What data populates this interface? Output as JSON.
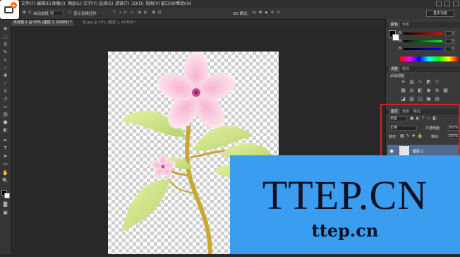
{
  "menu": [
    {
      "label": "文件(F)"
    },
    {
      "label": "编辑(E)"
    },
    {
      "label": "图像(I)"
    },
    {
      "label": "图层(L)"
    },
    {
      "label": "文字(Y)"
    },
    {
      "label": "选择(S)"
    },
    {
      "label": "滤镜(T)"
    },
    {
      "label": "3D(D)"
    },
    {
      "label": "视图(V)"
    },
    {
      "label": "窗口(W)"
    },
    {
      "label": "帮助(H)"
    }
  ],
  "options_bar": {
    "auto_select_label": "自动选择:",
    "auto_select_value": "组",
    "show_transform_label": "显示变换控件",
    "mode_3d_label": "3D 模式:",
    "workspace": "基本功能"
  },
  "doc_tabs": [
    {
      "label": "未标题-1 @ 50% (图层 2, RGB/8) *"
    },
    {
      "label": "花.jpg @ 50% (图层 1, RGB/8) *"
    }
  ],
  "color_panel": {
    "tabs": [
      "颜色",
      "色板"
    ],
    "channels": [
      {
        "label": "R",
        "value": "0"
      },
      {
        "label": "G",
        "value": "0"
      },
      {
        "label": "B",
        "value": "0"
      }
    ]
  },
  "adjustments_panel": {
    "tabs": [
      "调整",
      "样式"
    ],
    "title": "添加调整"
  },
  "layers_panel": {
    "tabs": [
      "图层",
      "通道",
      "路径"
    ],
    "kind_filter": "类型",
    "blend_mode": "正常",
    "opacity_label": "不透明度:",
    "opacity_value": "100%",
    "lock_label": "锁定:",
    "fill_label": "填充:",
    "fill_value": "100%",
    "layer_name": "图层 2"
  },
  "watermark": {
    "big": "TTEP.CN",
    "small": "ttep.cn"
  },
  "icons": [
    "move-tool-icon",
    "marquee-icon",
    "lasso-icon",
    "quick-select-icon",
    "crop-icon",
    "eyedropper-icon",
    "healing-icon",
    "brush-icon",
    "stamp-icon",
    "history-brush-icon",
    "eraser-icon",
    "gradient-icon",
    "blur-icon",
    "dodge-icon",
    "pen-icon",
    "type-icon",
    "path-select-icon",
    "shape-icon",
    "hand-icon",
    "zoom-icon",
    "eye-icon"
  ],
  "colors": {
    "accent_layer": "#4f6b8f",
    "highlight_frame": "#d62020",
    "watermark_bg": "#3a9df0"
  }
}
